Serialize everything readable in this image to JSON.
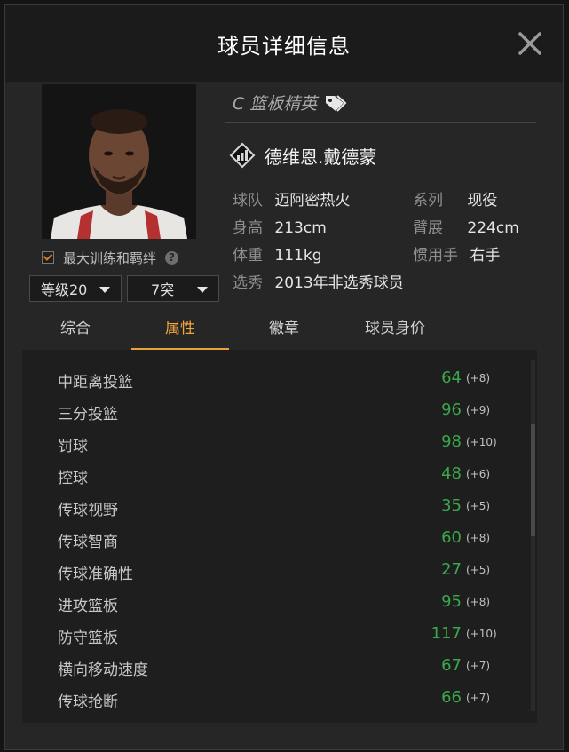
{
  "dialog": {
    "title": "球员详细信息"
  },
  "player": {
    "role": "C 篮板精英",
    "name": "德维恩.戴德蒙",
    "team_label": "球队",
    "team": "迈阿密热火",
    "series_label": "系列",
    "series": "现役",
    "height_label": "身高",
    "height": "213cm",
    "wingspan_label": "臂展",
    "wingspan": "224cm",
    "weight_label": "体重",
    "weight": "111kg",
    "hand_label": "惯用手",
    "hand": "右手",
    "draft_label": "选秀",
    "draft": "2013年非选秀球员"
  },
  "controls": {
    "bond_label": "最大训练和羁绊",
    "bond_checked": true,
    "level_select": "等级20",
    "breakthrough_select": "7突"
  },
  "tabs": [
    "综合",
    "属性",
    "徽章",
    "球员身价"
  ],
  "active_tab": "属性",
  "attributes": [
    {
      "name": "中距离投篮",
      "value": "64",
      "bonus": "(+8)"
    },
    {
      "name": "三分投篮",
      "value": "96",
      "bonus": "(+9)"
    },
    {
      "name": "罚球",
      "value": "98",
      "bonus": "(+10)"
    },
    {
      "name": "控球",
      "value": "48",
      "bonus": "(+6)"
    },
    {
      "name": "传球视野",
      "value": "35",
      "bonus": "(+5)"
    },
    {
      "name": "传球智商",
      "value": "60",
      "bonus": "(+8)"
    },
    {
      "name": "传球准确性",
      "value": "27",
      "bonus": "(+5)"
    },
    {
      "name": "进攻篮板",
      "value": "95",
      "bonus": "(+8)"
    },
    {
      "name": "防守篮板",
      "value": "117",
      "bonus": "(+10)"
    },
    {
      "name": "横向移动速度",
      "value": "67",
      "bonus": "(+7)"
    },
    {
      "name": "传球抢断",
      "value": "66",
      "bonus": "(+7)"
    }
  ],
  "colors": {
    "accent": "#f0a63a",
    "value_green": "#3aa84a"
  }
}
